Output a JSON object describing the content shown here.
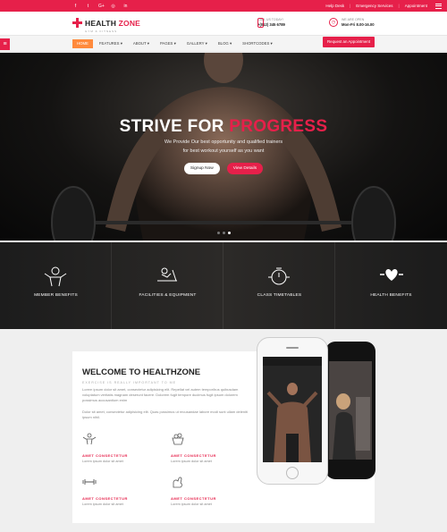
{
  "topbar": {
    "social": [
      "f",
      "t",
      "G+",
      "◎",
      "in"
    ],
    "links": [
      "Help Desk",
      "Emergency Services",
      "Appointment"
    ]
  },
  "header": {
    "logo_part1": "HEALTH",
    "logo_part2": "ZONE",
    "logo_tagline": "GYM & FITNESS",
    "call_label": "CALL US TODAY!",
    "call_value": "+(012) 345 6789",
    "open_label": "WE ARE OPEN",
    "open_value": "Mon-Fri 8.00-16.00"
  },
  "nav": {
    "items": [
      "HOME",
      "FEATURES ▾",
      "ABOUT ▾",
      "PAGES ▾",
      "GALLERY ▾",
      "BLOG ▾",
      "SHORTCODES ▾"
    ],
    "cta": "Request an Appointment"
  },
  "hero": {
    "title_white": "STRIVE FOR ",
    "title_red": "PROGRESS",
    "line1": "We Provide Our best opportunity and qualified trainers",
    "line2": "for best workout yourself as you want",
    "btn_signup": "Signup Now",
    "btn_details": "View Details"
  },
  "features": [
    "MEMBER BENEFITS",
    "FACILITIES & EQUIPMENT",
    "CLASS TIMETABLES",
    "HEALTH BENEFITS"
  ],
  "welcome": {
    "title": "WELCOME TO HEALTHZONE",
    "subtitle": "EXERCISE IS REALLY IMPORTANT TO ME",
    "p1": "Lorem ipsum dolor sit amet, consectetur adipisicing elit. Repellat vel autem tempor/bus quibusdam voluptatum veritatis magnam deserunt facere. Dolorem fugit tempore ducimus fugit ipsum dolorem possimus accusantium enim",
    "p2": "Dolor sit amet, consectetur adipisicing elit. Quas possimus ut recusandae labore modi sunt ullam deleniti ipsum nihil.",
    "services": [
      {
        "title": "AMET CONSECTETUR",
        "text": "Lorem ipsum dolor sit amet"
      },
      {
        "title": "AMET CONSECTETUR",
        "text": "Lorem ipsum dolor sit amet"
      },
      {
        "title": "AMET CONSECTETUR",
        "text": "Lorem ipsum dolor sit amet"
      },
      {
        "title": "AMET CONSECTETUR",
        "text": "Lorem ipsum dolor sit amet"
      }
    ]
  },
  "colors": {
    "accent": "#e6204a",
    "nav_active": "#ff8a3c"
  }
}
